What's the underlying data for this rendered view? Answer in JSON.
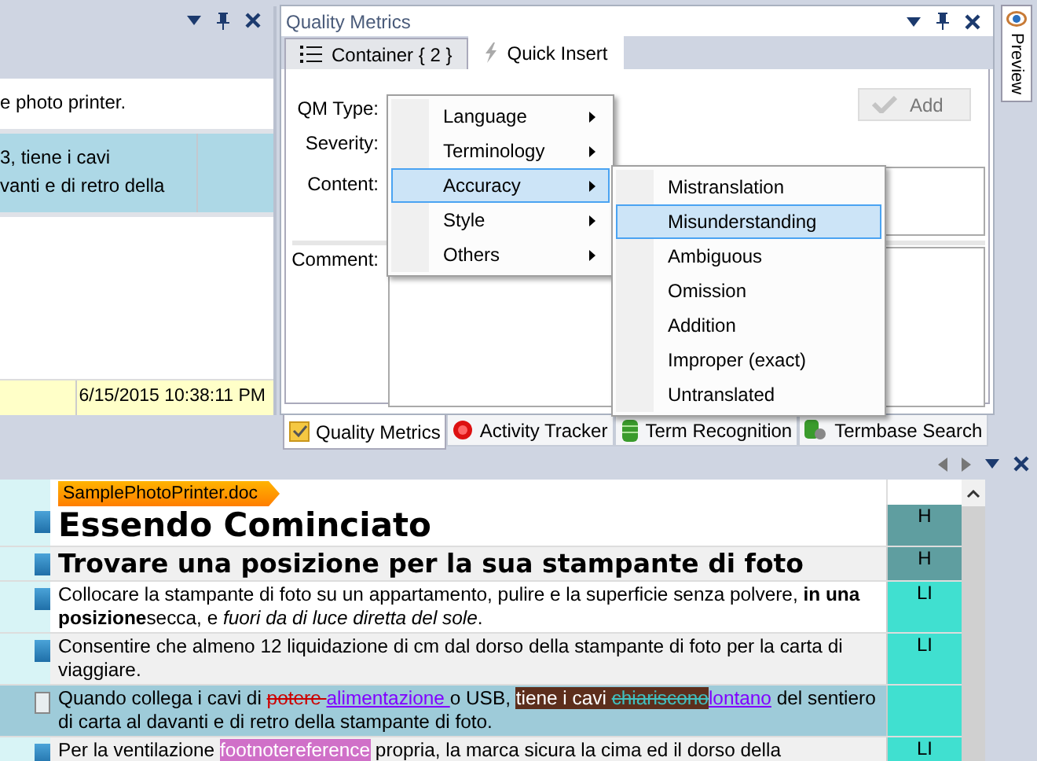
{
  "left_pane": {
    "rows": [
      {
        "lines": [
          "e photo printer."
        ],
        "selected": false
      },
      {
        "lines": [
          "3, tiene i cavi",
          "vanti e di retro della"
        ],
        "selected": true
      }
    ],
    "timestamp": "6/15/2015 10:38:11 PM"
  },
  "quality_metrics": {
    "title": "Quality Metrics",
    "tabs": [
      {
        "label": "Container { 2 }",
        "selected": false
      },
      {
        "label": "Quick Insert",
        "selected": true
      }
    ],
    "labels": [
      "QM Type:",
      "Severity:",
      "Content:",
      "Comment:"
    ],
    "add_button": {
      "label": "Add",
      "disabled": true
    },
    "menu": [
      {
        "label": "Language",
        "selected": false
      },
      {
        "label": "Terminology",
        "selected": false
      },
      {
        "label": "Accuracy",
        "selected": true
      },
      {
        "label": "Style",
        "selected": false
      },
      {
        "label": "Others",
        "selected": false
      }
    ],
    "submenu": [
      {
        "label": "Mistranslation",
        "selected": false
      },
      {
        "label": "Misunderstanding",
        "selected": true
      },
      {
        "label": "Ambiguous",
        "selected": false
      },
      {
        "label": "Omission",
        "selected": false
      },
      {
        "label": "Addition",
        "selected": false
      },
      {
        "label": "Improper (exact)",
        "selected": false
      },
      {
        "label": "Untranslated",
        "selected": false
      }
    ]
  },
  "side_tab": {
    "label": "Preview"
  },
  "bottom_tabs": [
    {
      "label": "Quality Metrics",
      "selected": true
    },
    {
      "label": "Activity Tracker",
      "selected": false
    },
    {
      "label": "Term Recognition",
      "selected": false
    },
    {
      "label": "Termbase Search",
      "selected": false
    }
  ],
  "editor": {
    "file_tag": "SamplePhotoPrinter.doc",
    "segments": [
      {
        "kind": "heading1",
        "confirmed": true,
        "selected": false,
        "style": {
          "label": "H",
          "color": "#5f9ea0"
        },
        "runs": [
          {
            "kind": "plain",
            "text": "Essendo Cominciato"
          }
        ]
      },
      {
        "kind": "heading2",
        "confirmed": true,
        "selected": false,
        "style": {
          "label": "H",
          "color": "#5f9ea0"
        },
        "runs": [
          {
            "kind": "plain",
            "text": "Trovare una posizione per la sua stampante di foto"
          }
        ]
      },
      {
        "kind": "body",
        "confirmed": true,
        "selected": false,
        "style": {
          "label": "LI",
          "color": "#40e0d0"
        },
        "runs": [
          {
            "kind": "plain",
            "text": "Collocare la stampante di foto su un appartamento, pulire e la superficie senza polvere, **in una posizione**secca, e *fuori da di luce diretta del sole*."
          }
        ]
      },
      {
        "kind": "body",
        "confirmed": true,
        "selected": false,
        "style": {
          "label": "LI",
          "color": "#40e0d0"
        },
        "runs": [
          {
            "kind": "plain",
            "text": "Consentire che almeno 12 liquidazione di cm dal dorso della stampante di foto per la carta di viaggiare."
          }
        ]
      },
      {
        "kind": "body",
        "confirmed": false,
        "selected": true,
        "style": {
          "color": "#40e0d0"
        },
        "runs": [
          {
            "kind": "plain",
            "text": "Quando collega i cavi di "
          },
          {
            "kind": "deleted",
            "text": "potere "
          },
          {
            "kind": "inserted",
            "text": "alimentazione "
          },
          {
            "kind": "plain",
            "text": "o USB, "
          },
          {
            "kind": "comment",
            "text": "tiene i cavi "
          },
          {
            "kind": "comment-deleted",
            "text": "chiariscono"
          },
          {
            "kind": "inserted",
            "text": "lontano"
          },
          {
            "kind": "plain",
            "text": " del sentiero di carta al davanti e di retro della stampante di foto."
          }
        ]
      },
      {
        "kind": "body",
        "confirmed": true,
        "selected": false,
        "style": {
          "label": "LI",
          "color": "#40e0d0"
        },
        "runs": [
          {
            "kind": "plain",
            "text": "Per la ventilazione "
          },
          {
            "kind": "tag",
            "text": "footnotereference"
          },
          {
            "kind": "plain",
            "text": " propria, la marca sicura la cima ed il dorso della"
          }
        ]
      }
    ]
  }
}
